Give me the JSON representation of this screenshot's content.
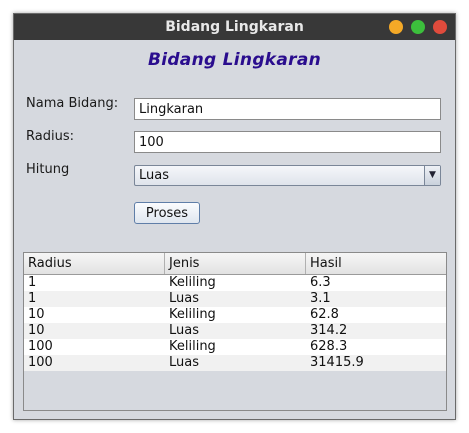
{
  "window": {
    "title": "Bidang Lingkaran"
  },
  "form": {
    "heading": "Bidang Lingkaran",
    "nama_label": "Nama Bidang:",
    "nama_value": "Lingkaran",
    "radius_label": "Radius:",
    "radius_value": "100",
    "hitung_label": "Hitung",
    "hitung_selected": "Luas",
    "proses_label": "Proses"
  },
  "table": {
    "headers": [
      "Radius",
      "Jenis",
      "Hasil"
    ],
    "rows": [
      [
        "1",
        "Keliling",
        "6.3"
      ],
      [
        "1",
        "Luas",
        "3.1"
      ],
      [
        "10",
        "Keliling",
        "62.8"
      ],
      [
        "10",
        "Luas",
        "314.2"
      ],
      [
        "100",
        "Keliling",
        "628.3"
      ],
      [
        "100",
        "Luas",
        "31415.9"
      ]
    ]
  },
  "colors": {
    "heading": "#2a0d8e",
    "titlebar": "#383838",
    "minimize": "#f4a927",
    "maximize": "#3cbf3c",
    "close": "#e04b3c"
  }
}
